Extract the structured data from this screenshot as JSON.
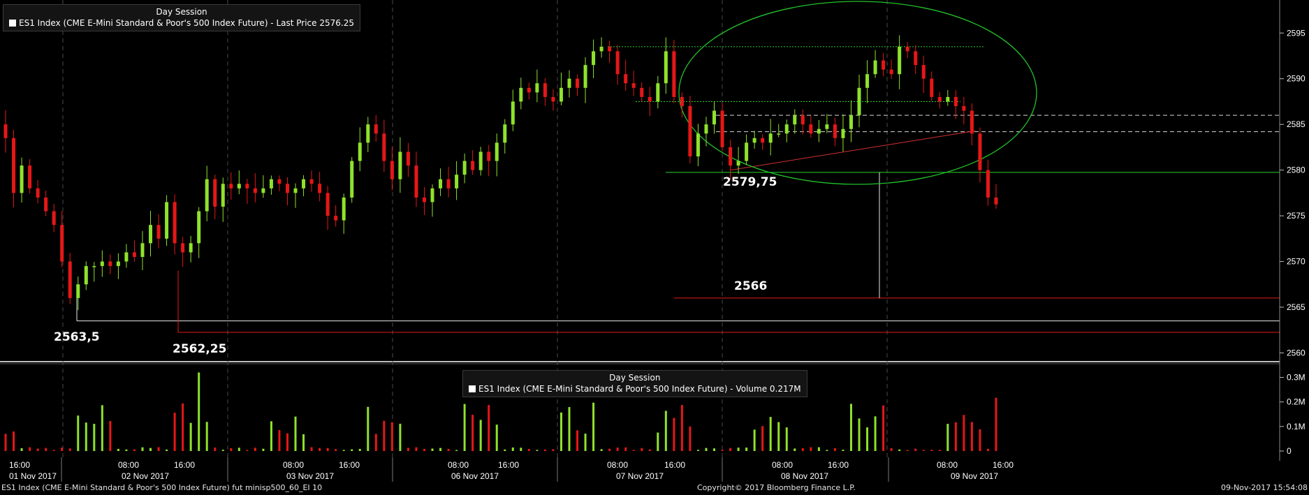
{
  "price_legend": {
    "session": "Day Session",
    "text": "ES1 Index (CME E-Mini Standard & Poor's 500 Index Future) - Last Price 2576.25"
  },
  "volume_legend": {
    "session": "Day Session",
    "text": "ES1 Index (CME E-Mini Standard & Poor's 500 Index Future) - Volume 0.217M"
  },
  "footer": {
    "left": "ES1 Index (CME E-Mini Standard & Poor's 500 Index Future) fut minisp500_60_EI 10",
    "center": "Copyright© 2017 Bloomberg Finance L.P.",
    "right": "09-Nov-2017 15:54:08"
  },
  "annotations": {
    "low_1": "2563,5",
    "low_2": "2562,25",
    "level_mid": "2579,75",
    "level_target": "2566"
  },
  "colors": {
    "up": "#8fe22b",
    "down": "#e61717",
    "background": "#000000",
    "ellipse": "#22c22a",
    "grid": "#4a4a4a"
  },
  "chart_data": [
    {
      "type": "candlestick",
      "title": "Day Session",
      "series_name": "ES1 Index (CME E-Mini Standard & Poor's 500 Index Future) - Last Price 2576.25",
      "y_ticks": [
        "2560",
        "2565",
        "2570",
        "2575",
        "2580",
        "2585",
        "2590",
        "2595"
      ],
      "ylim": [
        2559.5,
        2598
      ],
      "x_time_labels": [
        "16:00",
        "08:00",
        "16:00",
        "08:00",
        "16:00",
        "08:00",
        "16:00",
        "08:00",
        "16:00",
        "08:00",
        "16:00",
        "08:00",
        "16:00"
      ],
      "x_date_labels": [
        "01 Nov 2017",
        "02 Nov 2017",
        "03 Nov 2017",
        "06 Nov 2017",
        "07 Nov 2017",
        "08 Nov 2017",
        "09 Nov 2017"
      ],
      "closes": [
        2583.5,
        2577.5,
        2580.5,
        2578.0,
        2577.0,
        2575.5,
        2574.0,
        2570.0,
        2566.0,
        2567.5,
        2569.5,
        2569.5,
        2570.0,
        2569.5,
        2570.0,
        2571.0,
        2570.5,
        2572.0,
        2574.0,
        2572.5,
        2576.5,
        2572.0,
        2571.0,
        2572.0,
        2575.5,
        2579.0,
        2576.0,
        2578.5,
        2578.0,
        2578.5,
        2578.0,
        2577.5,
        2578.0,
        2579.0,
        2578.5,
        2577.5,
        2578.0,
        2579.0,
        2578.5,
        2577.5,
        2575.0,
        2574.5,
        2577.0,
        2581.0,
        2583.0,
        2585.0,
        2584.0,
        2581.0,
        2579.0,
        2582.0,
        2580.5,
        2577.0,
        2576.5,
        2578.0,
        2579.0,
        2578.0,
        2579.5,
        2581.0,
        2580.0,
        2582.0,
        2581.0,
        2583.0,
        2585.0,
        2587.5,
        2589.0,
        2588.5,
        2589.5,
        2588.0,
        2587.5,
        2589.0,
        2590.0,
        2589.0,
        2591.5,
        2593.0,
        2593.5,
        2593.0,
        2590.5,
        2589.5,
        2589.0,
        2588.0,
        2587.5,
        2589.5,
        2593.0,
        2588.0,
        2587.0,
        2581.5,
        2584.0,
        2585.0,
        2586.5,
        2582.5,
        2580.5,
        2581.0,
        2583.0,
        2583.5,
        2583.0,
        2584.0,
        2584.0,
        2585.0,
        2586.0,
        2585.0,
        2584.0,
        2584.5,
        2585.0,
        2583.5,
        2584.5,
        2586.0,
        2589.0,
        2590.5,
        2592.0,
        2591.0,
        2590.5,
        2593.5,
        2593.0,
        2591.5,
        2590.0,
        2588.0,
        2587.5,
        2588.0,
        2587.0,
        2586.5,
        2584.0,
        2580.0,
        2577.0,
        2576.25
      ],
      "volume": {
        "name": "ES1 Index (CME E-Mini Standard & Poor's 500 Index Future) - Volume 0.217M",
        "y_ticks": [
          "0",
          "0.1M",
          "0.2M",
          "0.3M"
        ],
        "ylim": [
          0,
          0.33
        ]
      }
    }
  ]
}
